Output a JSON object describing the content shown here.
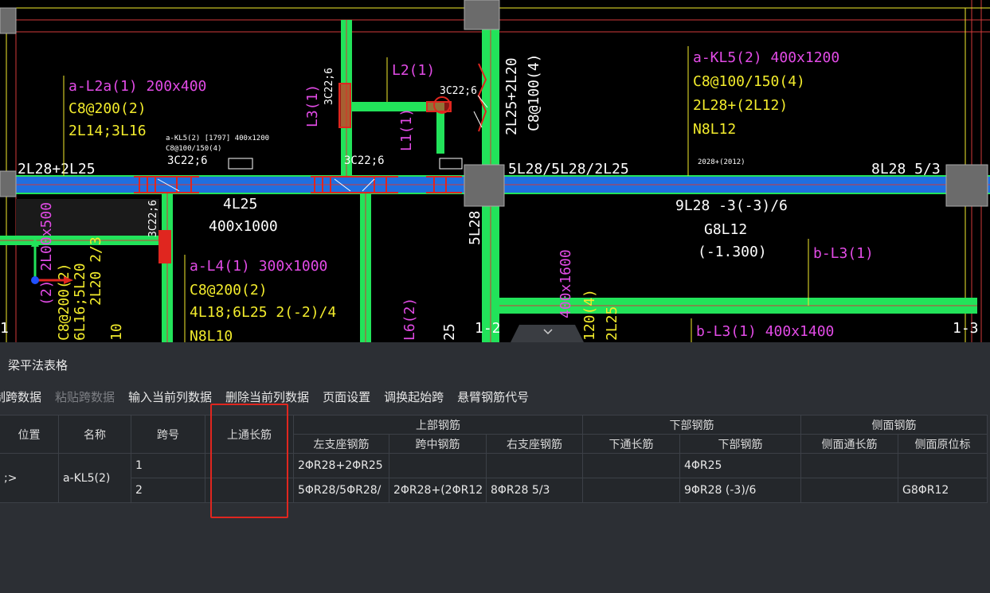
{
  "cad": {
    "labels": {
      "l2a_name": "a-L2a(1) 200x400",
      "l2a_stirrup": "C8@200(2)",
      "l2a_bars": "2L14;3L16",
      "kl5_name": "a-KL5(2) 400x1200",
      "kl5_stirrup": "C8@100/150(4)",
      "kl5_top": "2L28+(2L12)",
      "kl5_side": "N8L12",
      "l4_name": "a-L4(1) 300x1000",
      "l4_stirrup": "C8@200(2)",
      "l4_bars": "4L18;6L25 2(-2)/4",
      "l4_side": "N8L10",
      "l2_name": "L2(1)",
      "l3_name": "L3(1)",
      "l1_name": "L1(1)",
      "c22_a": "3C22;6",
      "c22_b": "3C22;6",
      "c22_c": "3C22;6",
      "c22_d": "3C22;6",
      "c22_e": "3C22;6",
      "col_top": "2L25+2L20",
      "col_stirrup": "C8@100(4)",
      "left_support": "2L28+2L25",
      "mid_support": "5L28/5L28/2L25",
      "right_support": "8L28 5/3",
      "bot_bars": "9L28 -3(-3)/6",
      "bot_side": "G8L12",
      "elevation": "(-1.300)",
      "b_l3": "b-L3(1)",
      "b_l3_full": "b-L3(1) 400x1400",
      "span_bot": "4L25",
      "span_size": "400x1000",
      "vert_5l28": "5L28",
      "vert_400": "400x1600",
      "small_note": "a-KL5(2) [1797] 400x1200",
      "small_note2": "C8@100/150(4)",
      "small_2028": "2028+(2012)",
      "grid_2": "1-2",
      "grid_3": "1-3",
      "grid_1": "1",
      "left_vert1": "2L20 2/3",
      "left_vert2": "(2) 2L00x500",
      "left_vert3": "C8@200(2)",
      "left_vert4": "6L16;5L20",
      "left_vert5": "10",
      "mid_vert1": "L6(2)",
      "mid_vert2": "25",
      "right_vert1": "120(4)",
      "right_vert2": "2L25"
    },
    "colors": {
      "beam_blue": "#1f6fe0",
      "beam_green": "#22e35a",
      "magenta": "#e24be6",
      "yellow": "#f3ec2c",
      "red": "#e0261f",
      "white": "#ffffff"
    }
  },
  "panel": {
    "title": "梁平法表格",
    "toolbar": [
      {
        "label": "制跨数据",
        "enabled": true
      },
      {
        "label": "粘贴跨数据",
        "enabled": false
      },
      {
        "label": "输入当前列数据",
        "enabled": true
      },
      {
        "label": "删除当前列数据",
        "enabled": true
      },
      {
        "label": "页面设置",
        "enabled": true
      },
      {
        "label": "调换起始跨",
        "enabled": true
      },
      {
        "label": "悬臂钢筋代号",
        "enabled": true
      }
    ],
    "table": {
      "headers": {
        "position": "位置",
        "name": "名称",
        "span": "跨号",
        "top_through": "上通长筋",
        "top_group": "上部钢筋",
        "bottom_group": "下部钢筋",
        "side_group": "侧面钢筋",
        "left_support": "左支座钢筋",
        "mid_span": "跨中钢筋",
        "right_support": "右支座钢筋",
        "bottom_through": "下通长筋",
        "bottom_bars": "下部钢筋",
        "side_through": "侧面通长筋",
        "side_original": "侧面原位标"
      },
      "position_value": ";>",
      "name_value": "a-KL5(2)",
      "rows": [
        {
          "span": "1",
          "top_through": "",
          "left_support": "2ΦR28+2ΦR25",
          "mid_span": "",
          "right_support": "",
          "bottom_through": "",
          "bottom_bars": "4ΦR25",
          "side_through": "",
          "side_original": ""
        },
        {
          "span": "2",
          "top_through": "",
          "left_support": "5ΦR28/5ΦR28/",
          "mid_span": "2ΦR28+(2ΦR12",
          "right_support": "8ΦR28 5/3",
          "bottom_through": "",
          "bottom_bars": "9ΦR28 (-3)/6",
          "side_through": "",
          "side_original": "G8ΦR12"
        }
      ]
    }
  }
}
